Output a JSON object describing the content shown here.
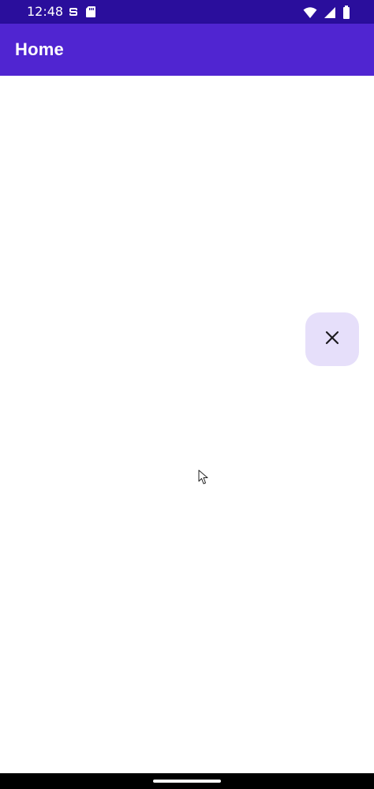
{
  "status_bar": {
    "time": "12:48",
    "left_icons": [
      "sync-icon",
      "sd-card-icon"
    ],
    "right_icons": [
      "wifi-icon",
      "signal-icon",
      "battery-icon"
    ],
    "background": "#2a0e9c"
  },
  "app_bar": {
    "title": "Home",
    "background": "#5025d1",
    "title_color": "#ffffff"
  },
  "fab": {
    "icon": "close-icon",
    "background": "#e6dffa"
  },
  "navigation": {
    "home_indicator": "home-indicator"
  }
}
